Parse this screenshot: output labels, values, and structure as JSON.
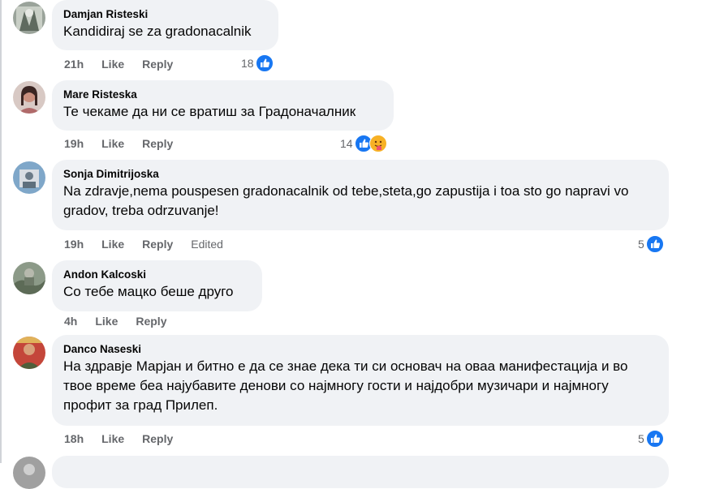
{
  "colors": {
    "bubble": "#f0f2f5",
    "meta": "#65676b",
    "like_blue": "#1877f2"
  },
  "comments": [
    {
      "author": "Damjan Risteski",
      "text": "Kandidiraj se za gradonacalnik",
      "time": "21h",
      "like": "Like",
      "reply": "Reply",
      "reaction_count": "18",
      "reactions": [
        "like-icon"
      ]
    },
    {
      "author": "Mare Risteska",
      "text": "Те чекаме да ни се вратиш за Градоначалник",
      "time": "19h",
      "like": "Like",
      "reply": "Reply",
      "reaction_count": "14",
      "reactions": [
        "like-icon",
        "care-icon"
      ]
    },
    {
      "author": "Sonja Dimitrijoska",
      "text": "Na zdravje,nema pouspesen gradonacalnik od tebe,steta,go zapustija i toa sto go napravi vo gradov, treba odrzuvanje!",
      "time": "19h",
      "like": "Like",
      "reply": "Reply",
      "edited": "Edited",
      "reaction_count": "5",
      "reactions": [
        "like-icon"
      ]
    },
    {
      "author": "Andon Kalcoski",
      "text": "Со тебе мацко беше друго",
      "time": "4h",
      "like": "Like",
      "reply": "Reply"
    },
    {
      "author": "Danco Naseski",
      "text": "На здравје Марјан и битно е да се знае дека ти си основач на оваа манифестација и во твое време беа најубавите денови со најмногу гости и најдобри музичари и најмногу профит за град Прилеп.",
      "time": "18h",
      "like": "Like",
      "reply": "Reply",
      "reaction_count": "5",
      "reactions": [
        "like-icon"
      ]
    }
  ]
}
